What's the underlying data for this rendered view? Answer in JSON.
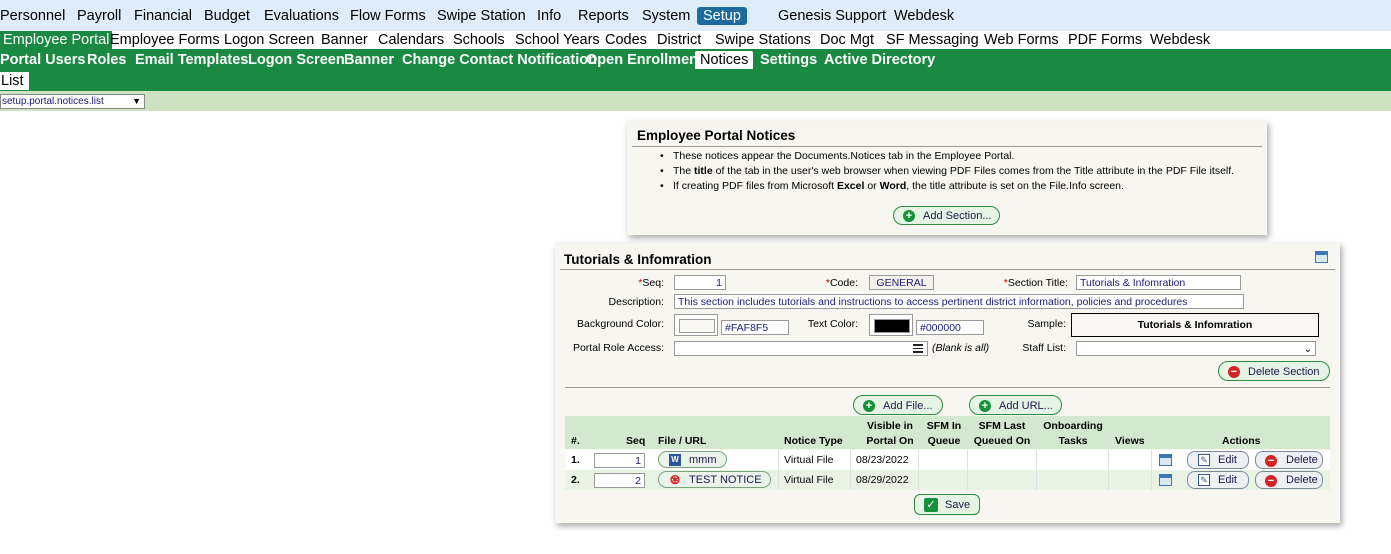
{
  "menu": [
    "Personnel",
    "Payroll",
    "Financial",
    "Budget",
    "Evaluations",
    "Flow Forms",
    "Swipe Station",
    "Info",
    "Reports",
    "System",
    "Setup",
    "Genesis Support",
    "Webdesk"
  ],
  "submenu1": [
    "Employee Portal",
    "Employee Forms",
    "Logon Screen",
    "Banner",
    "Calendars",
    "Schools",
    "School Years",
    "Codes",
    "District",
    "Swipe Stations",
    "Doc Mgt",
    "SF Messaging",
    "Web Forms",
    "PDF Forms",
    "Webdesk"
  ],
  "submenu2": [
    "Portal Users",
    "Roles",
    "Email Templates",
    "Logon Screen",
    "Banner",
    "Change Contact Notification",
    "Open Enrollment",
    "Notices",
    "Settings",
    "Active Directory"
  ],
  "submenu3": [
    "List"
  ],
  "page_select": "setup.portal.notices.list",
  "notices_panel": {
    "title": "Employee Portal Notices",
    "bullets": [
      [
        "These notices appear the Documents.Notices tab in the Employee Portal."
      ],
      [
        "The ",
        "title",
        " of the tab in the user's web browser when viewing PDF Files comes from the Title attribute in the PDF File itself."
      ],
      [
        "If creating PDF files from Microsoft ",
        "Excel",
        " or ",
        "Word",
        ", the title attribute is set on the File.Info screen."
      ]
    ],
    "add_section": "Add Section..."
  },
  "section": {
    "title": "Tutorials & Infomration",
    "seq_label": "*Seq:",
    "seq": "1",
    "code_label": "*Code:",
    "code": "GENERAL",
    "section_title_label": "*Section Title:",
    "section_title": "Tutorials & Infomration",
    "description_label": "Description:",
    "description": "This section includes tutorials and instructions to access pertinent district information, policies and procedures",
    "bg_color_label": "Background Color:",
    "bg_color": "#FAF8F5",
    "text_color_label": "Text Color:",
    "text_color": "#000000",
    "sample_label": "Sample:",
    "sample_text": "Tutorials & Infomration",
    "role_access_label": "Portal Role Access:",
    "role_access_hint": "(Blank is all)",
    "staff_list_label": "Staff List:",
    "delete_section": "Delete Section",
    "add_file": "Add File...",
    "add_url": "Add URL...",
    "save": "Save"
  },
  "table": {
    "headers": {
      "num": "#.",
      "seq": "Seq",
      "file": "File / URL",
      "type": "Notice Type",
      "visible1": "Visible in",
      "visible2": "Portal On",
      "sfmq1": "SFM In",
      "sfmq2": "Queue",
      "sfml1": "SFM Last",
      "sfml2": "Queued On",
      "onb1": "Onboarding",
      "onb2": "Tasks",
      "views": "Views",
      "actions": "Actions"
    },
    "rows": [
      {
        "num": "1.",
        "seq": "1",
        "file": "mmm",
        "type": "Virtual File",
        "visible": "08/23/2022",
        "icon": "word-icon"
      },
      {
        "num": "2.",
        "seq": "2",
        "file": "TEST NOTICE",
        "type": "Virtual File",
        "visible": "08/29/2022",
        "icon": "pdf-icon"
      }
    ],
    "edit": "Edit",
    "delete": "Delete"
  }
}
